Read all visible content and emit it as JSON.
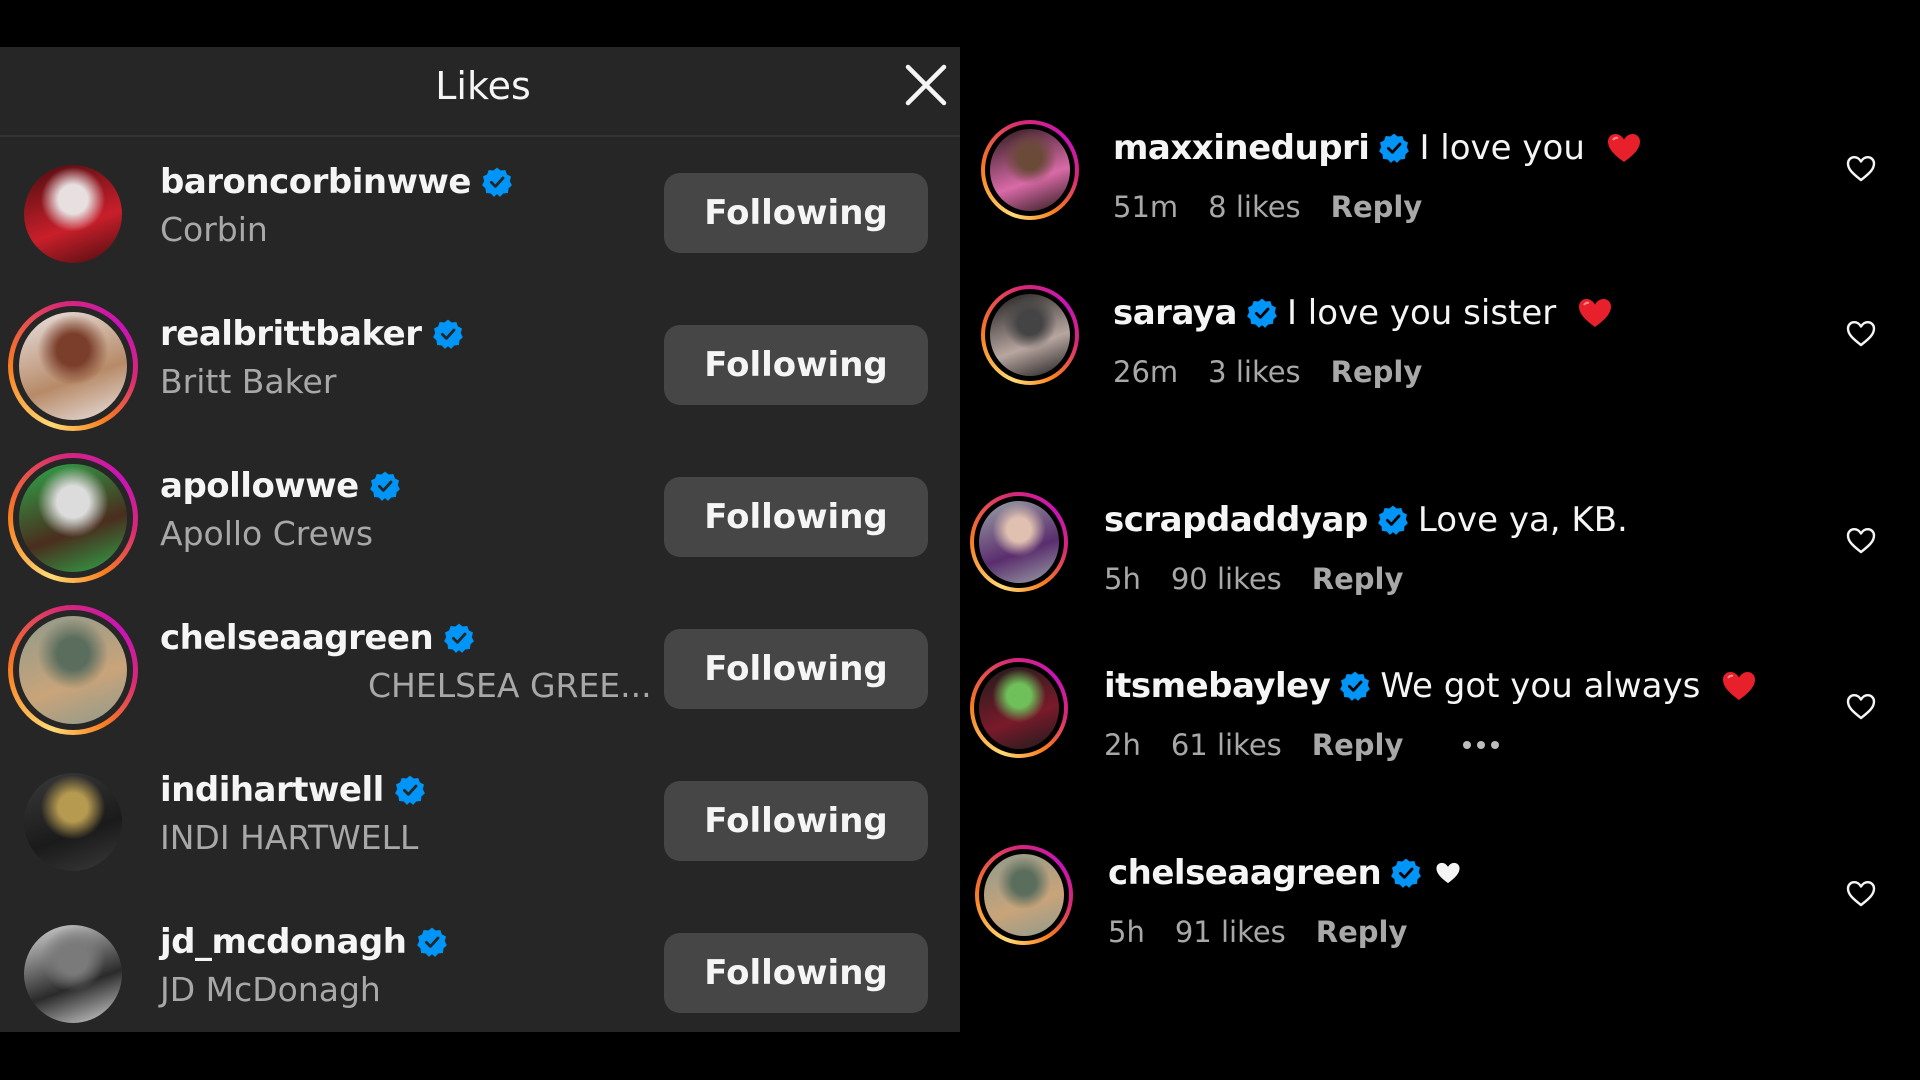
{
  "likes_panel": {
    "title": "Likes",
    "close_icon": "close-icon",
    "users": [
      {
        "username": "baroncorbinwwe",
        "full_name": "Corbin",
        "verified": true,
        "story_ring": false,
        "button": "Following",
        "avatar_colors": [
          "#4a0d10",
          "#c91f2a",
          "#e8e0e0"
        ]
      },
      {
        "username": "realbrittbaker",
        "full_name": "Britt Baker",
        "verified": true,
        "story_ring": true,
        "button": "Following",
        "avatar_colors": [
          "#e9e2e2",
          "#b78a67",
          "#7a3e2a"
        ]
      },
      {
        "username": "apollowwe",
        "full_name": "Apollo Crews",
        "verified": true,
        "story_ring": true,
        "button": "Following",
        "avatar_colors": [
          "#2ea84a",
          "#4a2d1e",
          "#dcdcdc"
        ]
      },
      {
        "username": "chelseaagreen",
        "full_name": "CHELSEA GREE...",
        "verified": true,
        "story_ring": true,
        "button": "Following",
        "avatar_colors": [
          "#8f9a8c",
          "#c9a47a",
          "#5b6e5e"
        ]
      },
      {
        "username": "indihartwell",
        "full_name": "INDI HARTWELL",
        "verified": true,
        "story_ring": false,
        "button": "Following",
        "avatar_colors": [
          "#3a3a3a",
          "#1a1a1a",
          "#b59a50"
        ]
      },
      {
        "username": "jd_mcdonagh",
        "full_name": "JD McDonagh",
        "verified": true,
        "story_ring": false,
        "button": "Following",
        "avatar_colors": [
          "#d9d9d9",
          "#2a2a2a",
          "#7a7a7a"
        ]
      }
    ]
  },
  "comments": [
    {
      "username": "maxxinedupri",
      "verified": true,
      "text": "I love you",
      "emoji": "red-heart",
      "time": "51m",
      "likes": "8 likes",
      "reply": "Reply",
      "more": false,
      "avatar_colors": [
        "#2a1a1a",
        "#d96aa8",
        "#6b4a3a"
      ]
    },
    {
      "username": "saraya",
      "verified": true,
      "text": "I love you sister",
      "emoji": "red-heart",
      "time": "26m",
      "likes": "3 likes",
      "reply": "Reply",
      "more": false,
      "avatar_colors": [
        "#1c1c1c",
        "#b8a6a0",
        "#444"
      ]
    },
    {
      "username": "scrapdaddyap",
      "verified": true,
      "text": "Love ya, KB.",
      "emoji": "",
      "time": "5h",
      "likes": "90 likes",
      "reply": "Reply",
      "more": false,
      "avatar_colors": [
        "#9aa1a6",
        "#5a2d6e",
        "#e0c0b0"
      ]
    },
    {
      "username": "itsmebayley",
      "verified": true,
      "text": "We got you always",
      "emoji": "red-heart",
      "time": "2h",
      "likes": "61 likes",
      "reply": "Reply",
      "more": true,
      "avatar_colors": [
        "#1c1c1c",
        "#7a1a2a",
        "#6fbf5a"
      ]
    },
    {
      "username": "chelseaagreen",
      "verified": true,
      "text": "",
      "emoji": "white-heart",
      "time": "5h",
      "likes": "91 likes",
      "reply": "Reply",
      "more": false,
      "avatar_colors": [
        "#8f9a8c",
        "#c9a47a",
        "#5b6e5e"
      ]
    }
  ],
  "colors": {
    "panel_bg": "#262626",
    "button_bg": "#464646",
    "verified_blue": "#0095f6",
    "secondary_text": "#a8a8a8",
    "emoji_red": "#e8202c"
  }
}
